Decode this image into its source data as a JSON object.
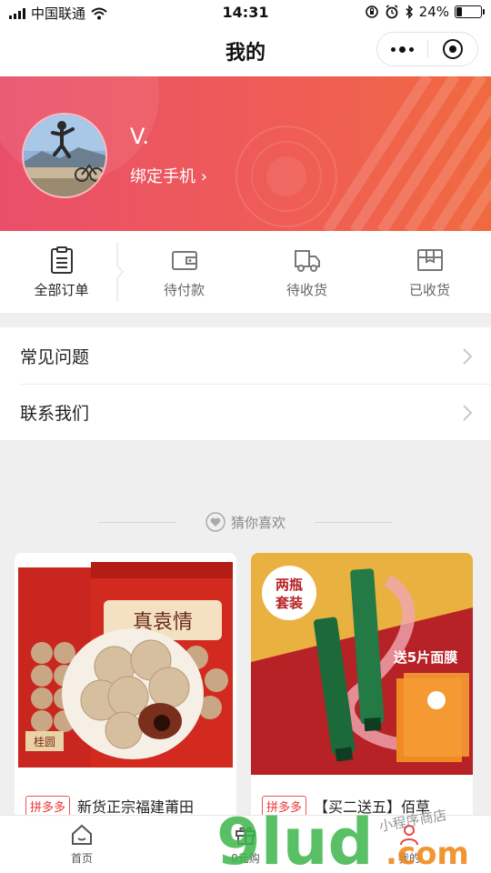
{
  "status_bar": {
    "carrier": "中国联通",
    "time": "14:31",
    "battery_percent": "24%",
    "battery_level": 0.24
  },
  "nav": {
    "title": "我的"
  },
  "profile": {
    "name": "V.",
    "bind_phone": "绑定手机 ›"
  },
  "orders": [
    {
      "label": "全部订单",
      "icon": "clipboard-icon"
    },
    {
      "label": "待付款",
      "icon": "wallet-icon"
    },
    {
      "label": "待收货",
      "icon": "truck-icon"
    },
    {
      "label": "已收货",
      "icon": "box-icon"
    }
  ],
  "menu": [
    {
      "label": "常见问题"
    },
    {
      "label": "联系我们"
    }
  ],
  "guess": {
    "label": "猜你喜欢"
  },
  "products": [
    {
      "tag": "拼多多",
      "title": "新货正宗福建莆田",
      "image_brand": "真袁情",
      "image_small": "桂圆"
    },
    {
      "tag": "拼多多",
      "title": "【买二送五】佰草",
      "image_badge": "两瓶 套装",
      "image_promo": "送5片面膜"
    }
  ],
  "tabs": [
    {
      "label": "首页",
      "icon": "home-icon"
    },
    {
      "label": "0元购",
      "icon": "gift-icon"
    },
    {
      "label": "我的",
      "icon": "user-icon"
    }
  ],
  "watermark": {
    "text": "9lud",
    "suffix": ".com",
    "tagline": "小程序商店"
  }
}
